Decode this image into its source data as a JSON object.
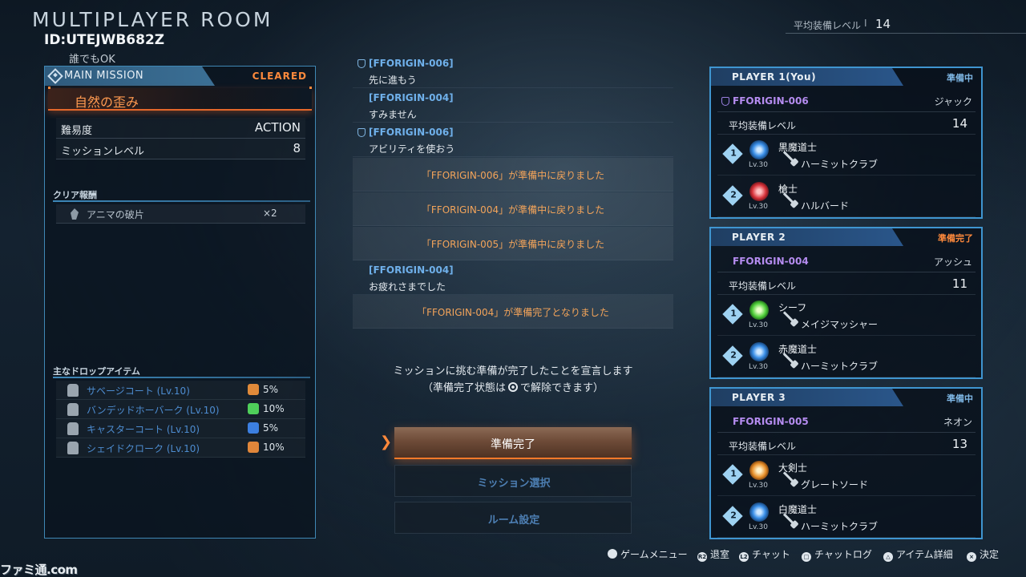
{
  "header": {
    "title": "MULTIPLAYER ROOM",
    "room_id": "ID:UTEJWB682Z",
    "access": "誰でもOK",
    "avg_label": "平均装備レベル",
    "avg_sep": "I",
    "avg_value": "14"
  },
  "mission": {
    "tab_label": "MAIN MISSION",
    "status": "CLEARED",
    "name": "自然の歪み",
    "difficulty_label": "難易度",
    "difficulty_value": "ACTION",
    "level_label": "ミッションレベル",
    "level_value": "8",
    "reward_title": "クリア報酬",
    "reward": {
      "name": "アニマの破片",
      "qty": "×2"
    },
    "drop_title": "主なドロップアイテム",
    "drops": [
      {
        "name": "サベージコート (Lv.10)",
        "rate": "5%",
        "rate_color": "#e08a3a"
      },
      {
        "name": "バンデッドホーバーク (Lv.10)",
        "rate": "10%",
        "rate_color": "#4fcf5a"
      },
      {
        "name": "キャスターコート (Lv.10)",
        "rate": "5%",
        "rate_color": "#3c7fe0"
      },
      {
        "name": "シェイドクローク (Lv.10)",
        "rate": "10%",
        "rate_color": "#e0863a"
      }
    ]
  },
  "chat": [
    {
      "type": "msg",
      "who": "[FFORIGIN-006]",
      "text": "先に進もう",
      "shield": true
    },
    {
      "type": "msg",
      "who": "[FFORIGIN-004]",
      "text": "すみません",
      "shield": false
    },
    {
      "type": "msg",
      "who": "[FFORIGIN-006]",
      "text": "アビリティを使おう",
      "shield": true
    },
    {
      "type": "sys",
      "text": "「FFORIGIN-006」が準備中に戻りました"
    },
    {
      "type": "sys",
      "text": "「FFORIGIN-004」が準備中に戻りました"
    },
    {
      "type": "sys",
      "text": "「FFORIGIN-005」が準備中に戻りました"
    },
    {
      "type": "msg",
      "who": "[FFORIGIN-004]",
      "text": "お疲れさまでした",
      "shield": false
    },
    {
      "type": "sys",
      "text": "「FFORIGIN-004」が準備完了となりました"
    }
  ],
  "declare": {
    "line1": "ミッションに挑む準備が完了したことを宣言します",
    "line2_a": "（準備完了状態は",
    "line2_b": "で解除できます）"
  },
  "buttons": {
    "ready": "準備完了",
    "mission_select": "ミッション選択",
    "room_settings": "ルーム設定"
  },
  "players": [
    {
      "label": "PLAYER 1(You)",
      "status": "準備中",
      "done": false,
      "name": "FFORIGIN-006",
      "character": "ジャック",
      "avg_label": "平均装備レベル",
      "avg": "14",
      "jobs": [
        {
          "num": "1",
          "job": "黒魔道士",
          "lv": "Lv.30",
          "weapon": "ハーミットクラブ",
          "color": "#3a8fe8"
        },
        {
          "num": "2",
          "job": "槍士",
          "lv": "Lv.30",
          "weapon": "ハルバード",
          "color": "#d8323a"
        }
      ]
    },
    {
      "label": "PLAYER 2",
      "status": "準備完了",
      "done": true,
      "name": "FFORIGIN-004",
      "character": "アッシュ",
      "avg_label": "平均装備レベル",
      "avg": "11",
      "jobs": [
        {
          "num": "1",
          "job": "シーフ",
          "lv": "Lv.30",
          "weapon": "メイジマッシャー",
          "color": "#4fcf3a"
        },
        {
          "num": "2",
          "job": "赤魔道士",
          "lv": "Lv.30",
          "weapon": "ハーミットクラブ",
          "color": "#3a8fe8"
        }
      ]
    },
    {
      "label": "PLAYER 3",
      "status": "準備中",
      "done": false,
      "name": "FFORIGIN-005",
      "character": "ネオン",
      "avg_label": "平均装備レベル",
      "avg": "13",
      "jobs": [
        {
          "num": "1",
          "job": "大剣士",
          "lv": "Lv.30",
          "weapon": "グレートソード",
          "color": "#e8902a"
        },
        {
          "num": "2",
          "job": "白魔道士",
          "lv": "Lv.30",
          "weapon": "ハーミットクラブ",
          "color": "#3a8fe8"
        }
      ]
    }
  ],
  "footer": [
    {
      "key": "game-menu",
      "glyph": "",
      "label": "ゲームメニュー"
    },
    {
      "key": "leave-room",
      "glyph": "R2",
      "label": "退室"
    },
    {
      "key": "chat",
      "glyph": "L2",
      "label": "チャット"
    },
    {
      "key": "chat-log",
      "glyph": "□",
      "label": "チャットログ"
    },
    {
      "key": "item-details",
      "glyph": "△",
      "label": "アイテム詳細"
    },
    {
      "key": "confirm",
      "glyph": "×",
      "label": "決定"
    }
  ],
  "watermark": "ファミ通.com"
}
